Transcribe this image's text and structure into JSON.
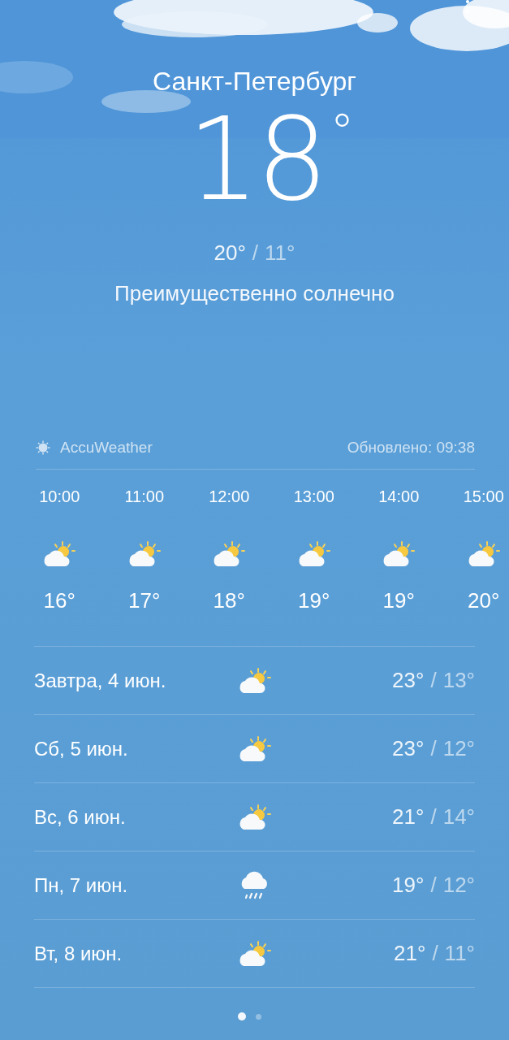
{
  "location": {
    "city": "Санкт-Петербург",
    "temperature": "18",
    "degree": "°",
    "high": "20°",
    "separator": "/",
    "low": "11°",
    "condition": "Преимущественно солнечно"
  },
  "source": {
    "name": "AccuWeather",
    "updated": "Обновлено: 09:38"
  },
  "hourly": [
    {
      "time": "10:00",
      "kind": "partly_sunny",
      "temp": "16°"
    },
    {
      "time": "11:00",
      "kind": "partly_sunny",
      "temp": "17°"
    },
    {
      "time": "12:00",
      "kind": "partly_sunny",
      "temp": "18°"
    },
    {
      "time": "13:00",
      "kind": "partly_sunny",
      "temp": "19°"
    },
    {
      "time": "14:00",
      "kind": "partly_sunny",
      "temp": "19°"
    },
    {
      "time": "15:00",
      "kind": "partly_sunny",
      "temp": "20°"
    }
  ],
  "daily": [
    {
      "day": "Завтра, 4 июн.",
      "kind": "partly_sunny",
      "high": "23°",
      "separator": "/",
      "low": "13°"
    },
    {
      "day": "Сб, 5 июн.",
      "kind": "partly_sunny",
      "high": "23°",
      "separator": "/",
      "low": "12°"
    },
    {
      "day": "Вс, 6 июн.",
      "kind": "partly_sunny",
      "high": "21°",
      "separator": "/",
      "low": "14°"
    },
    {
      "day": "Пн, 7 июн.",
      "kind": "rain",
      "high": "19°",
      "separator": "/",
      "low": "12°"
    },
    {
      "day": "Вт, 8 июн.",
      "kind": "partly_sunny",
      "high": "21°",
      "separator": "/",
      "low": "11°"
    }
  ],
  "pages": [
    {
      "selected": true
    },
    {
      "selected": false
    }
  ]
}
